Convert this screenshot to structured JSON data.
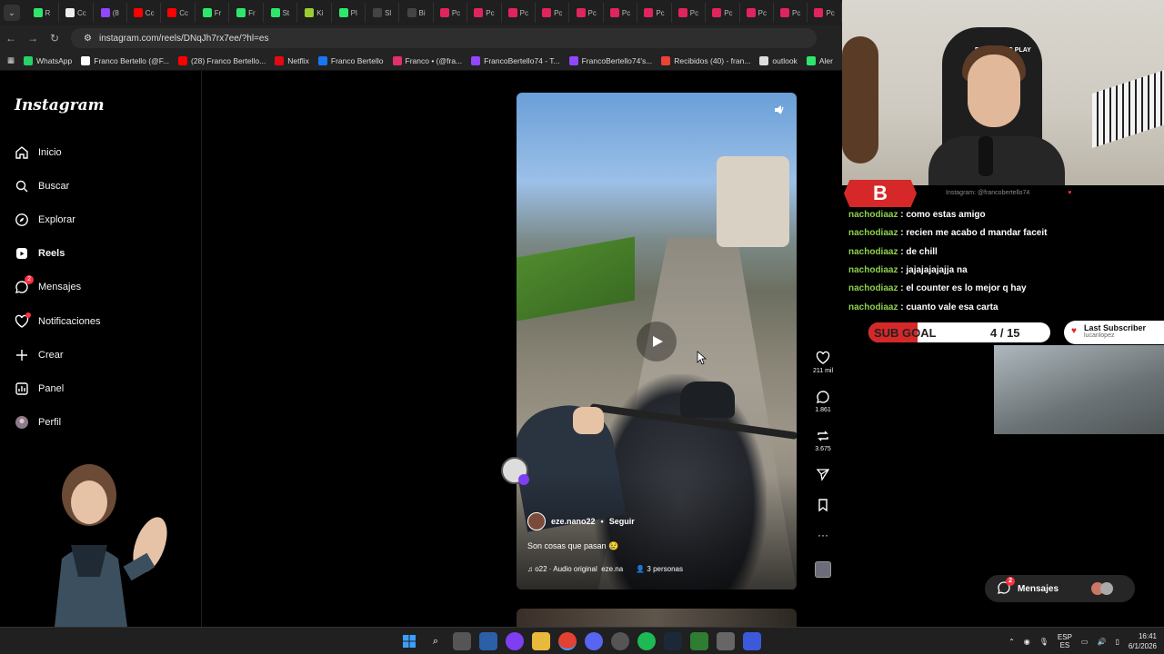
{
  "browser": {
    "url": "instagram.com/reels/DNqJh7rx7ee/?hl=es",
    "tabs": [
      {
        "label": "R",
        "color": "#2ee66b"
      },
      {
        "label": "Cc",
        "color": "#eeeeee"
      },
      {
        "label": "(8",
        "color": "#9146ff"
      },
      {
        "label": "Cc",
        "color": "#ff0000"
      },
      {
        "label": "Cc",
        "color": "#ff0000"
      },
      {
        "label": "Fr",
        "color": "#2ee66b"
      },
      {
        "label": "Fr",
        "color": "#2ee66b"
      },
      {
        "label": "St",
        "color": "#2ee66b"
      },
      {
        "label": "Ki",
        "color": "#9acd32"
      },
      {
        "label": "Pl",
        "color": "#2ee66b"
      },
      {
        "label": "Sl",
        "color": "#444444"
      },
      {
        "label": "Bi",
        "color": "#444444"
      },
      {
        "label": "Pc",
        "color": "#e0245e"
      },
      {
        "label": "Pc",
        "color": "#e0245e"
      },
      {
        "label": "Pc",
        "color": "#e0245e"
      },
      {
        "label": "Pc",
        "color": "#e0245e"
      },
      {
        "label": "Pc",
        "color": "#e0245e"
      },
      {
        "label": "Pc",
        "color": "#e0245e"
      },
      {
        "label": "Pc",
        "color": "#e0245e"
      },
      {
        "label": "Pc",
        "color": "#e0245e"
      },
      {
        "label": "Pc",
        "color": "#e0245e"
      },
      {
        "label": "Pc",
        "color": "#e0245e"
      },
      {
        "label": "Pc",
        "color": "#e0245e"
      },
      {
        "label": "Pc",
        "color": "#e0245e"
      }
    ],
    "bookmarks": [
      {
        "label": "WhatsApp",
        "color": "#25d366"
      },
      {
        "label": "Franco Bertello (@F...",
        "color": "#ffffff"
      },
      {
        "label": "(28) Franco Bertello...",
        "color": "#ff0000"
      },
      {
        "label": "Netflix",
        "color": "#e50914"
      },
      {
        "label": "Franco Bertello",
        "color": "#1877f2"
      },
      {
        "label": "Franco • (@fra...",
        "color": "#e1306c"
      },
      {
        "label": "FrancoBertello74 - T...",
        "color": "#9146ff"
      },
      {
        "label": "FrancoBertello74's...",
        "color": "#9146ff"
      },
      {
        "label": "Recibidos (40) - fran...",
        "color": "#ea4335"
      },
      {
        "label": "outlook",
        "color": "#dddddd"
      },
      {
        "label": "Aler",
        "color": "#2ee66b"
      }
    ]
  },
  "instagram": {
    "logo": "Instagram",
    "nav": [
      {
        "label": "Inicio",
        "icon": "home-icon"
      },
      {
        "label": "Buscar",
        "icon": "search-icon"
      },
      {
        "label": "Explorar",
        "icon": "compass-icon"
      },
      {
        "label": "Reels",
        "icon": "reels-icon"
      },
      {
        "label": "Mensajes",
        "icon": "messenger-icon",
        "badge": "2"
      },
      {
        "label": "Notificaciones",
        "icon": "heart-icon"
      },
      {
        "label": "Crear",
        "icon": "plus-icon"
      },
      {
        "label": "Panel",
        "icon": "chart-icon"
      },
      {
        "label": "Perfil",
        "icon": "avatar-icon"
      }
    ],
    "reel": {
      "username": "eze.nano22",
      "follow": "Seguir",
      "caption": "Son cosas que pasan",
      "caption_emoji": "😢",
      "audio": "o22 · Audio original",
      "audio_user": "eze.na",
      "people": "3 personas"
    },
    "actions": {
      "likes": "211 mil",
      "comments": "1.861",
      "reposts": "3.675"
    }
  },
  "stream": {
    "webcam_brand": "PRAGMATIC PLAY",
    "logo_letter": "B",
    "instagram_handle": "Instagram: @francobertello74",
    "chat": [
      {
        "user": "nachodiaaz",
        "text": ": como estas amigo"
      },
      {
        "user": "nachodiaaz",
        "text": ": recien me acabo d mandar faceit"
      },
      {
        "user": "nachodiaaz",
        "text": ": de chill"
      },
      {
        "user": "nachodiaaz",
        "text": ": jajajajajajja na"
      },
      {
        "user": "nachodiaaz",
        "text": ": el counter es lo mejor q hay"
      },
      {
        "user": "nachodiaaz",
        "text": ": cuanto vale esa carta"
      }
    ],
    "sub_goal": {
      "label": "SUB GOAL",
      "count": "4 / 15",
      "progress": 0.27
    },
    "last_subscriber": {
      "title": "Last Subscriber",
      "name": "lucanlopez"
    },
    "messages_pill": {
      "label": "Mensajes",
      "badge": "2"
    }
  },
  "taskbar": {
    "lang_top": "ESP",
    "lang_bottom": "ES",
    "time": "16:41",
    "date": "6/1/2026"
  }
}
